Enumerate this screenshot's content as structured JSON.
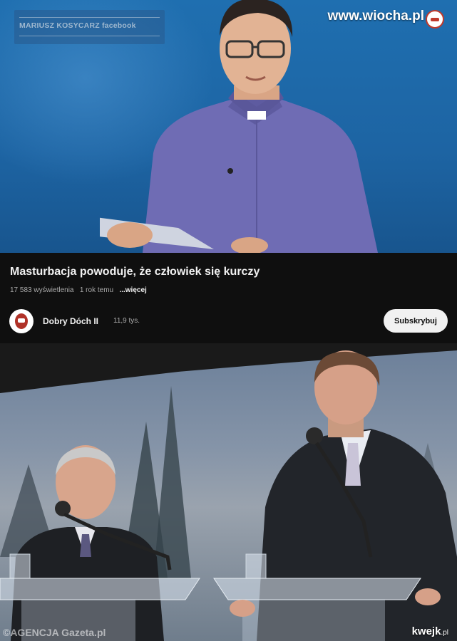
{
  "video_frame": {
    "channel_banner_text": "MARIUSZ KOSYCARZ facebook",
    "watermark": "www.wiocha.pl"
  },
  "video_info": {
    "title": "Masturbacja powoduje, że człowiek się kurczy",
    "views": "17 583 wyświetlenia",
    "age": "1 rok temu",
    "more_link": "...więcej",
    "channel": {
      "name": "Dobry Dóch II",
      "subscribers": "11,9 tys."
    },
    "subscribe_label": "Subskrybuj"
  },
  "photo": {
    "credit": "©AGENCJA Gazeta.pl",
    "watermark": "kwejk",
    "watermark_tld": ".pl"
  },
  "colors": {
    "video_bg": "#1d64a3",
    "panel_bg": "#0f0f0f",
    "subscribe_bg": "#f1f1f1"
  }
}
